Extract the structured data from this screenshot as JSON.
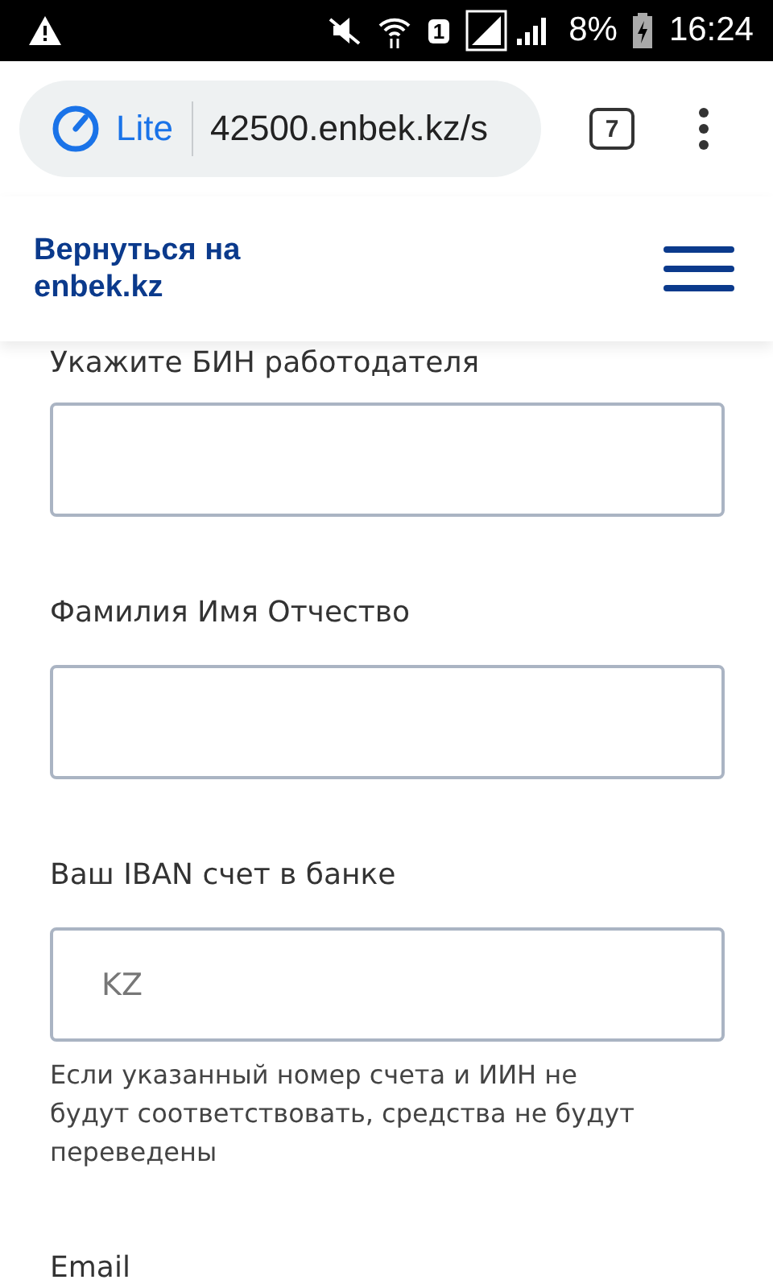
{
  "status_bar": {
    "battery": "8%",
    "time": "16:24",
    "sim_slot": "1"
  },
  "browser": {
    "lite_label": "Lite",
    "url": "42500.enbek.kz/s",
    "tab_count": "7"
  },
  "header": {
    "back_link": "Вернуться на enbek.kz"
  },
  "form": {
    "fields": [
      {
        "kind": "input",
        "label": "Укажите БИН работодателя"
      },
      {
        "kind": "input",
        "label": "Фамилия Имя Отчество"
      },
      {
        "kind": "input",
        "label": "Ваш IBAN счет в банке",
        "placeholder": "KZ",
        "hint": "Если указанный номер счета и ИИН не будут соответствовать, средства не будут переведены"
      },
      {
        "kind": "label",
        "label": "Email"
      }
    ]
  }
}
